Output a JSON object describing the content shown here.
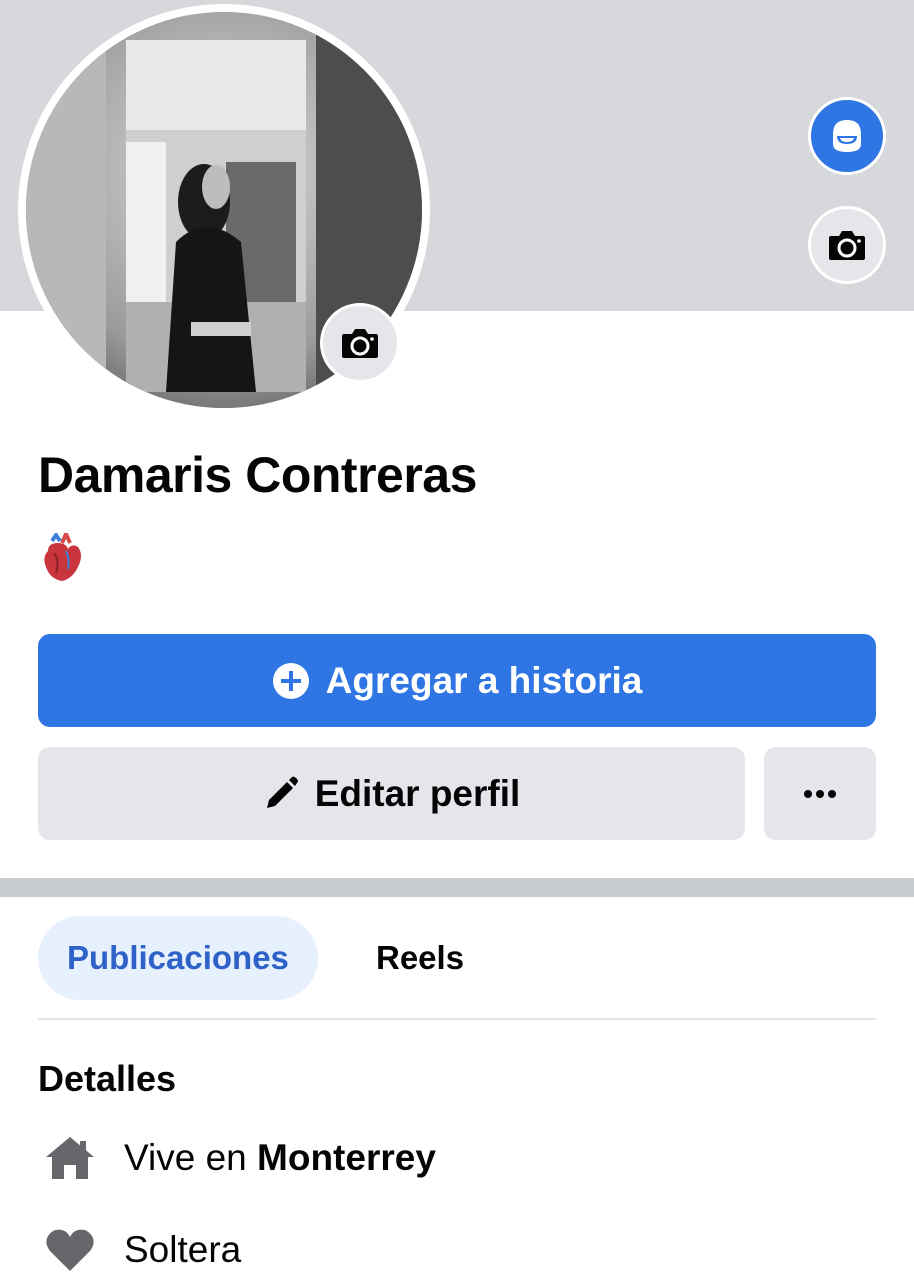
{
  "profile": {
    "name": "Damaris Contreras",
    "bio_emoji": "anatomical-heart-emoji"
  },
  "actions": {
    "add_story_label": "Agregar a historia",
    "edit_profile_label": "Editar perfil",
    "more_label": "···"
  },
  "tabs": [
    {
      "label": "Publicaciones",
      "active": true
    },
    {
      "label": "Reels",
      "active": false
    }
  ],
  "details": {
    "title": "Detalles",
    "lives_in_prefix": "Vive en",
    "lives_in_city": "Monterrey",
    "relationship": "Soltera"
  },
  "colors": {
    "accent": "#2f76e4",
    "cover": "#d6d8dc",
    "button_gray": "#e4e6eb",
    "tab_active_bg": "#e7f0fd",
    "tab_active_text": "#2f62c8"
  },
  "icons": [
    "camera-icon",
    "avatar-icon",
    "plus-circle-icon",
    "pencil-icon",
    "more-dots-icon",
    "home-icon",
    "heart-icon"
  ]
}
